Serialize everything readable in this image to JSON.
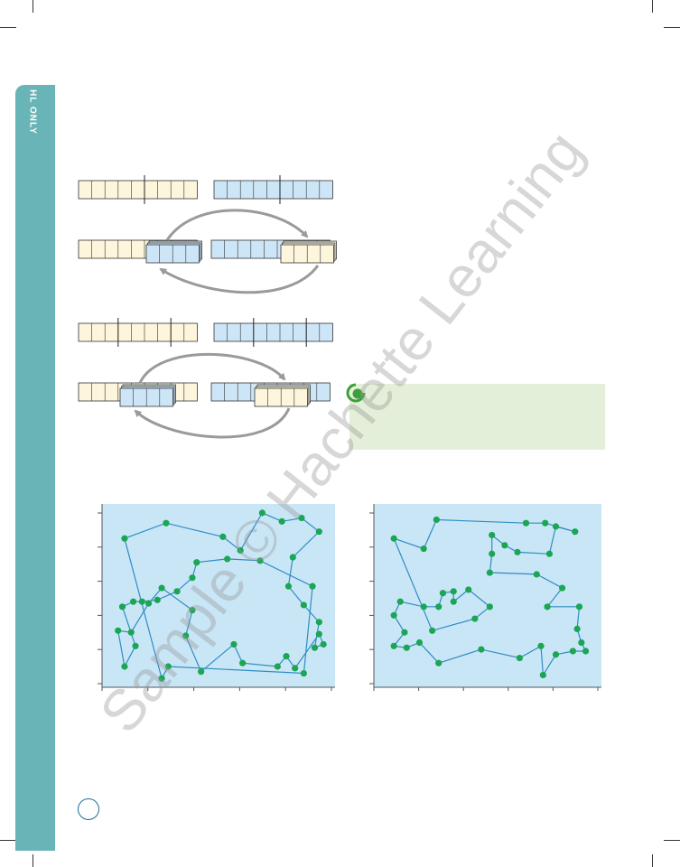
{
  "sidebar": {
    "label": "HL ONLY",
    "color": "#69b4b6"
  },
  "watermark": {
    "text": "Sample © Hachette Learning"
  },
  "colors": {
    "parent_a": "#fdf6dc",
    "parent_b": "#cde6f7",
    "plot_bg": "#c9e6f6",
    "route_line": "#2f8cc4",
    "city_point": "#1aa653",
    "arrow": "#9a9a9a",
    "info_box": "#e4efd9",
    "info_icon": "#3aa13a"
  },
  "icons": {
    "info": "green-circle-icon"
  },
  "chart_data": [
    {
      "type": "scatter",
      "title": "",
      "xlabel": "",
      "ylabel": "",
      "xlim": [
        0,
        100
      ],
      "ylim": [
        0,
        100
      ],
      "grid": false,
      "connected": true,
      "points": [
        [
          7,
          84
        ],
        [
          26,
          93
        ],
        [
          52,
          85
        ],
        [
          60,
          77
        ],
        [
          70,
          99
        ],
        [
          79,
          94
        ],
        [
          88,
          96
        ],
        [
          96,
          88
        ],
        [
          84,
          73
        ],
        [
          82,
          56
        ],
        [
          89,
          45
        ],
        [
          96,
          35
        ],
        [
          94,
          20
        ],
        [
          98,
          22
        ],
        [
          96,
          28
        ],
        [
          85,
          8
        ],
        [
          81,
          15
        ],
        [
          77,
          9
        ],
        [
          61,
          11
        ],
        [
          57,
          22
        ],
        [
          42,
          6
        ],
        [
          35,
          27
        ],
        [
          38,
          42
        ],
        [
          24,
          55
        ],
        [
          18,
          46
        ],
        [
          10,
          29
        ],
        [
          4,
          30
        ],
        [
          7,
          9
        ],
        [
          12,
          21
        ],
        [
          6,
          44
        ],
        [
          11,
          47
        ],
        [
          15,
          47
        ],
        [
          22,
          48
        ],
        [
          31,
          53
        ],
        [
          38,
          61
        ],
        [
          40,
          70
        ],
        [
          54,
          72
        ],
        [
          69,
          71
        ],
        [
          93,
          56
        ],
        [
          89,
          5
        ],
        [
          27,
          9
        ],
        [
          24,
          2
        ]
      ]
    },
    {
      "type": "scatter",
      "title": "",
      "xlabel": "",
      "ylabel": "",
      "xlim": [
        0,
        100
      ],
      "ylim": [
        0,
        100
      ],
      "grid": false,
      "connected": true,
      "points": [
        [
          6,
          84
        ],
        [
          20,
          78
        ],
        [
          26,
          95
        ],
        [
          68,
          93
        ],
        [
          77,
          93
        ],
        [
          91,
          88
        ],
        [
          82,
          91
        ],
        [
          79,
          75
        ],
        [
          64,
          76
        ],
        [
          58,
          80
        ],
        [
          52,
          86
        ],
        [
          52,
          75
        ],
        [
          51,
          64
        ],
        [
          73,
          63
        ],
        [
          85,
          55
        ],
        [
          78,
          44
        ],
        [
          93,
          44
        ],
        [
          92,
          31
        ],
        [
          94,
          23
        ],
        [
          96,
          18
        ],
        [
          90,
          18
        ],
        [
          82,
          16
        ],
        [
          76,
          4
        ],
        [
          75,
          21
        ],
        [
          65,
          14
        ],
        [
          47,
          19
        ],
        [
          27,
          11
        ],
        [
          18,
          23
        ],
        [
          12,
          20
        ],
        [
          6,
          21
        ],
        [
          11,
          29
        ],
        [
          6,
          39
        ],
        [
          9,
          47
        ],
        [
          20,
          44
        ],
        [
          27,
          44
        ],
        [
          29,
          52
        ],
        [
          34,
          53
        ],
        [
          34,
          47
        ],
        [
          41,
          54
        ],
        [
          51,
          44
        ],
        [
          44,
          37
        ],
        [
          24,
          30
        ]
      ]
    }
  ]
}
